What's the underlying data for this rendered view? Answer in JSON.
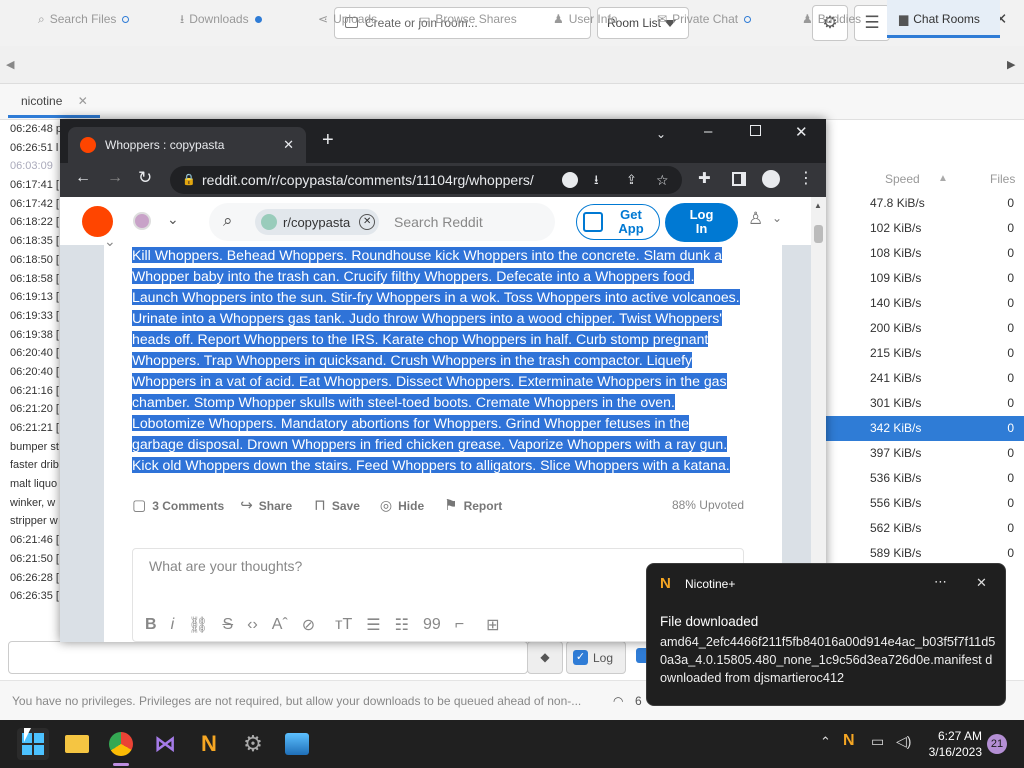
{
  "nicotine": {
    "room_entry_placeholder": "Create or join room...",
    "room_list_label": "Room List",
    "tabs": [
      {
        "label": "Search Files",
        "dot": true
      },
      {
        "label": "Downloads",
        "dot": true
      },
      {
        "label": "Uploads",
        "dot": false
      },
      {
        "label": "Browse Shares",
        "dot": false
      },
      {
        "label": "User Info",
        "dot": false
      },
      {
        "label": "Private Chat",
        "dot": true
      },
      {
        "label": "Buddies",
        "dot": false
      },
      {
        "label": "Chat Rooms",
        "dot": false
      }
    ],
    "room_tab": "nicotine",
    "chat_lines": [
      "06:26:48 p",
      "06:26:51 l",
      "06:03:09",
      "06:17:41 [",
      "06:17:42 [",
      "06:18:22 [",
      "06:18:35 [",
      "06:18:50 [",
      "06:18:58 [",
      "06:19:13 [",
      "06:19:33 [",
      "06:19:38 [",
      "06:20:40 [",
      "06:20:40 [",
      "06:21:16 [",
      "06:21:20 [",
      "06:21:21 [",
      "bumper st",
      "faster drib",
      "malt liquo",
      "winker, w",
      "stripper w",
      "06:21:46 [",
      "06:21:50 [",
      "06:26:28 [",
      "06:26:35 ["
    ],
    "user_header": {
      "speed": "Speed",
      "files": "Files"
    },
    "users": [
      {
        "speed": "47.8 KiB/s",
        "files": "0"
      },
      {
        "speed": "102 KiB/s",
        "files": "0"
      },
      {
        "speed": "108 KiB/s",
        "files": "0"
      },
      {
        "speed": "109 KiB/s",
        "files": "0"
      },
      {
        "speed": "140 KiB/s",
        "files": "0"
      },
      {
        "speed": "200 KiB/s",
        "files": "0"
      },
      {
        "speed": "215 KiB/s",
        "files": "0"
      },
      {
        "speed": "241 KiB/s",
        "files": "0"
      },
      {
        "speed": "301 KiB/s",
        "files": "0"
      },
      {
        "speed": "342 KiB/s",
        "files": "0",
        "selected": true
      },
      {
        "speed": "397 KiB/s",
        "files": "0"
      },
      {
        "speed": "536 KiB/s",
        "files": "0"
      },
      {
        "speed": "556 KiB/s",
        "files": "0"
      },
      {
        "speed": "562 KiB/s",
        "files": "0"
      },
      {
        "speed": "589 KiB/s",
        "files": "0"
      }
    ],
    "log_label": "Log",
    "status_text": "You have no privileges. Privileges are not required, but allow your downloads to be queued ahead of non-...",
    "status_count": "6"
  },
  "chrome": {
    "tab_title": "Whoppers : copypasta",
    "url": "reddit.com/r/copypasta/comments/11104rg/whoppers/",
    "reddit": {
      "subreddit_chip": "r/copypasta",
      "search_placeholder": "Search Reddit",
      "get_app": "Get App",
      "login": "Log In",
      "post_text": "Kill Whoppers. Behead Whoppers. Roundhouse kick Whoppers into the concrete. Slam dunk a Whopper baby into the trash can. Crucify filthy Whoppers. Defecate into a Whoppers food. Launch Whoppers into the sun. Stir-fry Whoppers in a wok. Toss Whoppers into active volcanoes. Urinate into a Whoppers gas tank. Judo throw Whoppers into a wood chipper. Twist Whoppers' heads off. Report Whoppers to the IRS. Karate chop Whoppers in half. Curb stomp pregnant Whoppers. Trap Whoppers in quicksand. Crush Whoppers in the trash compactor. Liquefy Whoppers in a vat of acid. Eat Whoppers. Dissect Whoppers. Exterminate Whoppers in the gas chamber. Stomp Whopper skulls with steel-toed boots. Cremate Whoppers in the oven. Lobotomize Whoppers. Mandatory abortions for Whoppers. Grind Whopper fetuses in the garbage disposal. Drown Whoppers in fried chicken grease. Vaporize Whoppers with a ray gun. Kick old Whoppers down the stairs. Feed Whoppers to alligators. Slice Whoppers with a katana.",
      "comments": "3 Comments",
      "share": "Share",
      "save": "Save",
      "hide": "Hide",
      "report": "Report",
      "upvoted": "88% Upvoted",
      "comment_placeholder": "What are your thoughts?"
    }
  },
  "toast": {
    "app": "Nicotine+",
    "title": "File downloaded",
    "body": "amd64_2efc4466f211f5fb84016a00d914e4ac_b03f5f7f11d50a3a_4.0.15805.480_none_1c9c56d3ea726d0e.manifest downloaded from djsmartieroc412"
  },
  "taskbar": {
    "time": "6:27 AM",
    "date": "3/16/2023",
    "badge": "21"
  },
  "colors": {
    "accent": "#2f7cd6",
    "selection": "#2f73d8",
    "reddit_orange": "#ff4500",
    "reddit_blue": "#0079d3"
  }
}
